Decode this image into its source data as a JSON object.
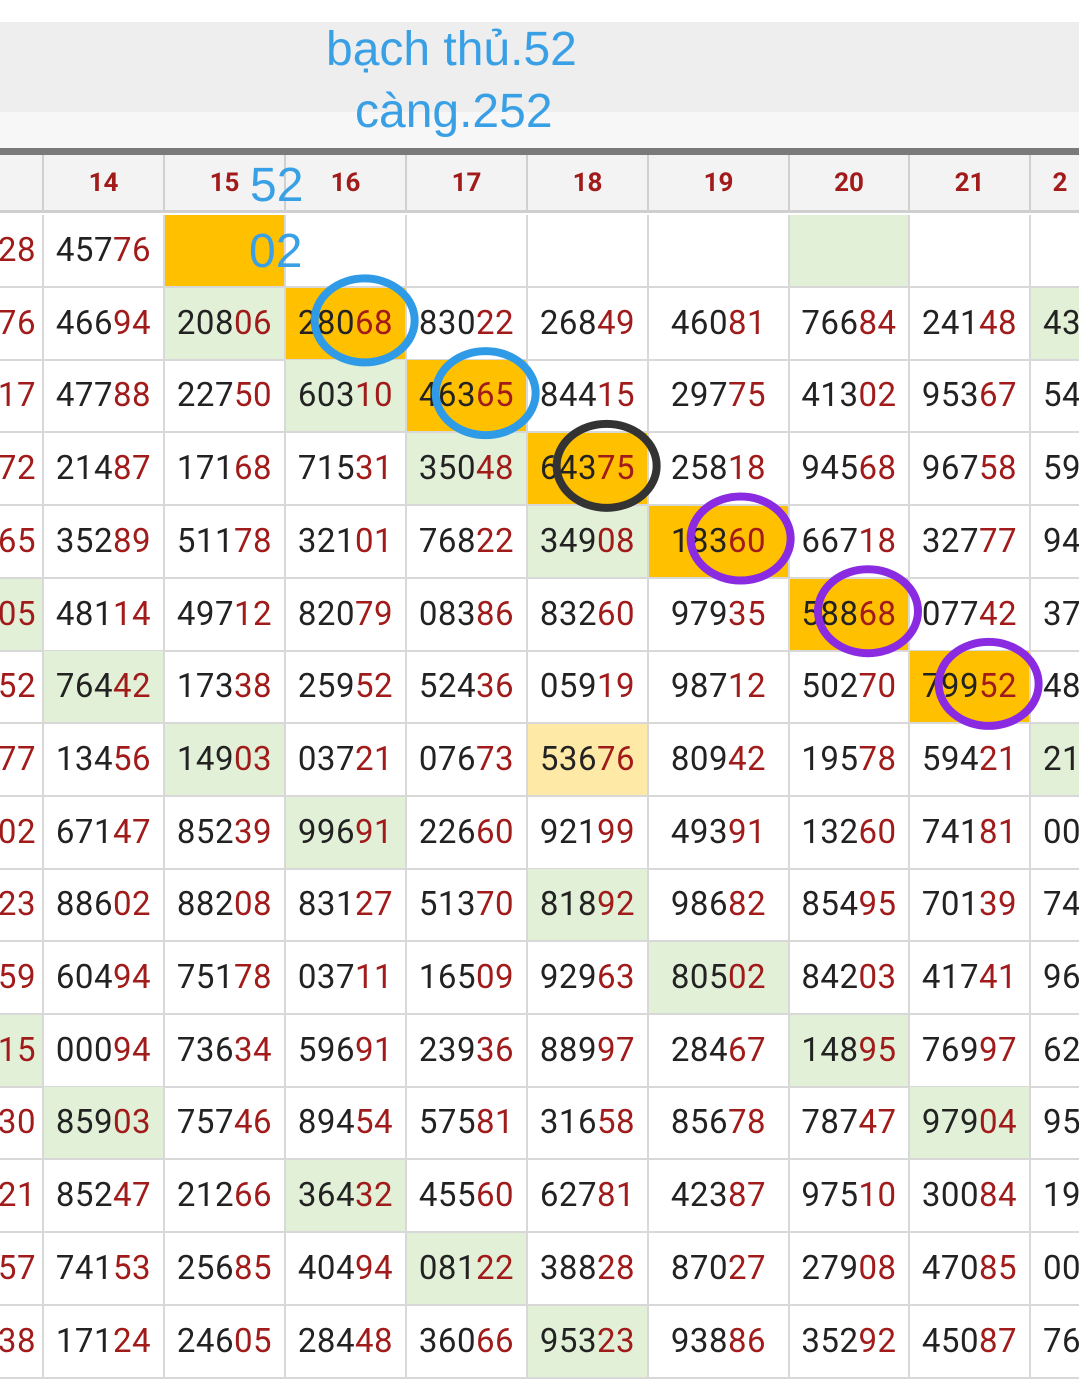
{
  "annotation": {
    "line1": "bạch thủ.52",
    "line2": "càng.252",
    "small_top": "52",
    "small_bottom": "02"
  },
  "columns": [
    "",
    "14",
    "15",
    "16",
    "17",
    "18",
    "19",
    "20",
    "21",
    "2"
  ],
  "rows": [
    [
      "28",
      "45776",
      "",
      "",
      "",
      "",
      "",
      "",
      ""
    ],
    [
      "76",
      "46694",
      "20806",
      "28068",
      "83022",
      "26849",
      "46081",
      "76684",
      "24148",
      "43"
    ],
    [
      "17",
      "47788",
      "22750",
      "60310",
      "46365",
      "84415",
      "29775",
      "41302",
      "95367",
      "54"
    ],
    [
      "72",
      "21487",
      "17168",
      "71531",
      "35048",
      "64375",
      "25818",
      "94568",
      "96758",
      "59"
    ],
    [
      "65",
      "35289",
      "51178",
      "32101",
      "76822",
      "34908",
      "18360",
      "66718",
      "32777",
      "94"
    ],
    [
      "05",
      "48114",
      "49712",
      "82079",
      "08386",
      "83260",
      "97935",
      "58868",
      "07742",
      "37"
    ],
    [
      "52",
      "76442",
      "17338",
      "25952",
      "52436",
      "05919",
      "98712",
      "50270",
      "79952",
      "48"
    ],
    [
      "77",
      "13456",
      "14903",
      "03721",
      "07673",
      "53676",
      "80942",
      "19578",
      "59421",
      "21"
    ],
    [
      "02",
      "67147",
      "85239",
      "99691",
      "22660",
      "92199",
      "49391",
      "13260",
      "74181",
      "00"
    ],
    [
      "23",
      "88602",
      "88208",
      "83127",
      "51370",
      "81892",
      "98682",
      "85495",
      "70139",
      "74"
    ],
    [
      "59",
      "60494",
      "75178",
      "03711",
      "16509",
      "92963",
      "80502",
      "84203",
      "41741",
      "96"
    ],
    [
      "15",
      "00094",
      "73634",
      "59691",
      "23936",
      "88997",
      "28467",
      "14895",
      "76997",
      "62"
    ],
    [
      "30",
      "85903",
      "75746",
      "89454",
      "57581",
      "31658",
      "85678",
      "78747",
      "97904",
      "95"
    ],
    [
      "21",
      "85247",
      "21266",
      "36432",
      "45560",
      "62781",
      "42387",
      "97510",
      "30084",
      "19"
    ],
    [
      "57",
      "74153",
      "25685",
      "40494",
      "08122",
      "38828",
      "87027",
      "27908",
      "47085",
      "00"
    ],
    [
      "38",
      "17124",
      "24605",
      "28448",
      "36066",
      "95323",
      "93886",
      "35292",
      "45087",
      "76"
    ]
  ],
  "highlights": {
    "green": [
      [
        0,
        7
      ],
      [
        1,
        2
      ],
      [
        1,
        9
      ],
      [
        2,
        3
      ],
      [
        3,
        4
      ],
      [
        4,
        5
      ],
      [
        5,
        0
      ],
      [
        6,
        1
      ],
      [
        7,
        2
      ],
      [
        7,
        9
      ],
      [
        8,
        3
      ],
      [
        9,
        5
      ],
      [
        10,
        6
      ],
      [
        11,
        0
      ],
      [
        11,
        7
      ],
      [
        12,
        1
      ],
      [
        12,
        8
      ],
      [
        13,
        3
      ],
      [
        14,
        4
      ],
      [
        15,
        5
      ]
    ],
    "orange": [
      [
        0,
        2
      ],
      [
        1,
        3
      ],
      [
        2,
        4
      ],
      [
        3,
        5
      ],
      [
        4,
        6
      ],
      [
        5,
        7
      ],
      [
        6,
        8
      ]
    ],
    "lightorange": [
      [
        7,
        5
      ]
    ]
  },
  "circles": [
    {
      "row": 1,
      "col": 3,
      "color": "#2f9be6"
    },
    {
      "row": 2,
      "col": 4,
      "color": "#2f9be6"
    },
    {
      "row": 3,
      "col": 5,
      "color": "#333333"
    },
    {
      "row": 4,
      "col": 6,
      "color": "#8a2be2"
    },
    {
      "row": 5,
      "col": 7,
      "color": "#8a2be2"
    },
    {
      "row": 6,
      "col": 8,
      "color": "#8a2be2"
    }
  ]
}
